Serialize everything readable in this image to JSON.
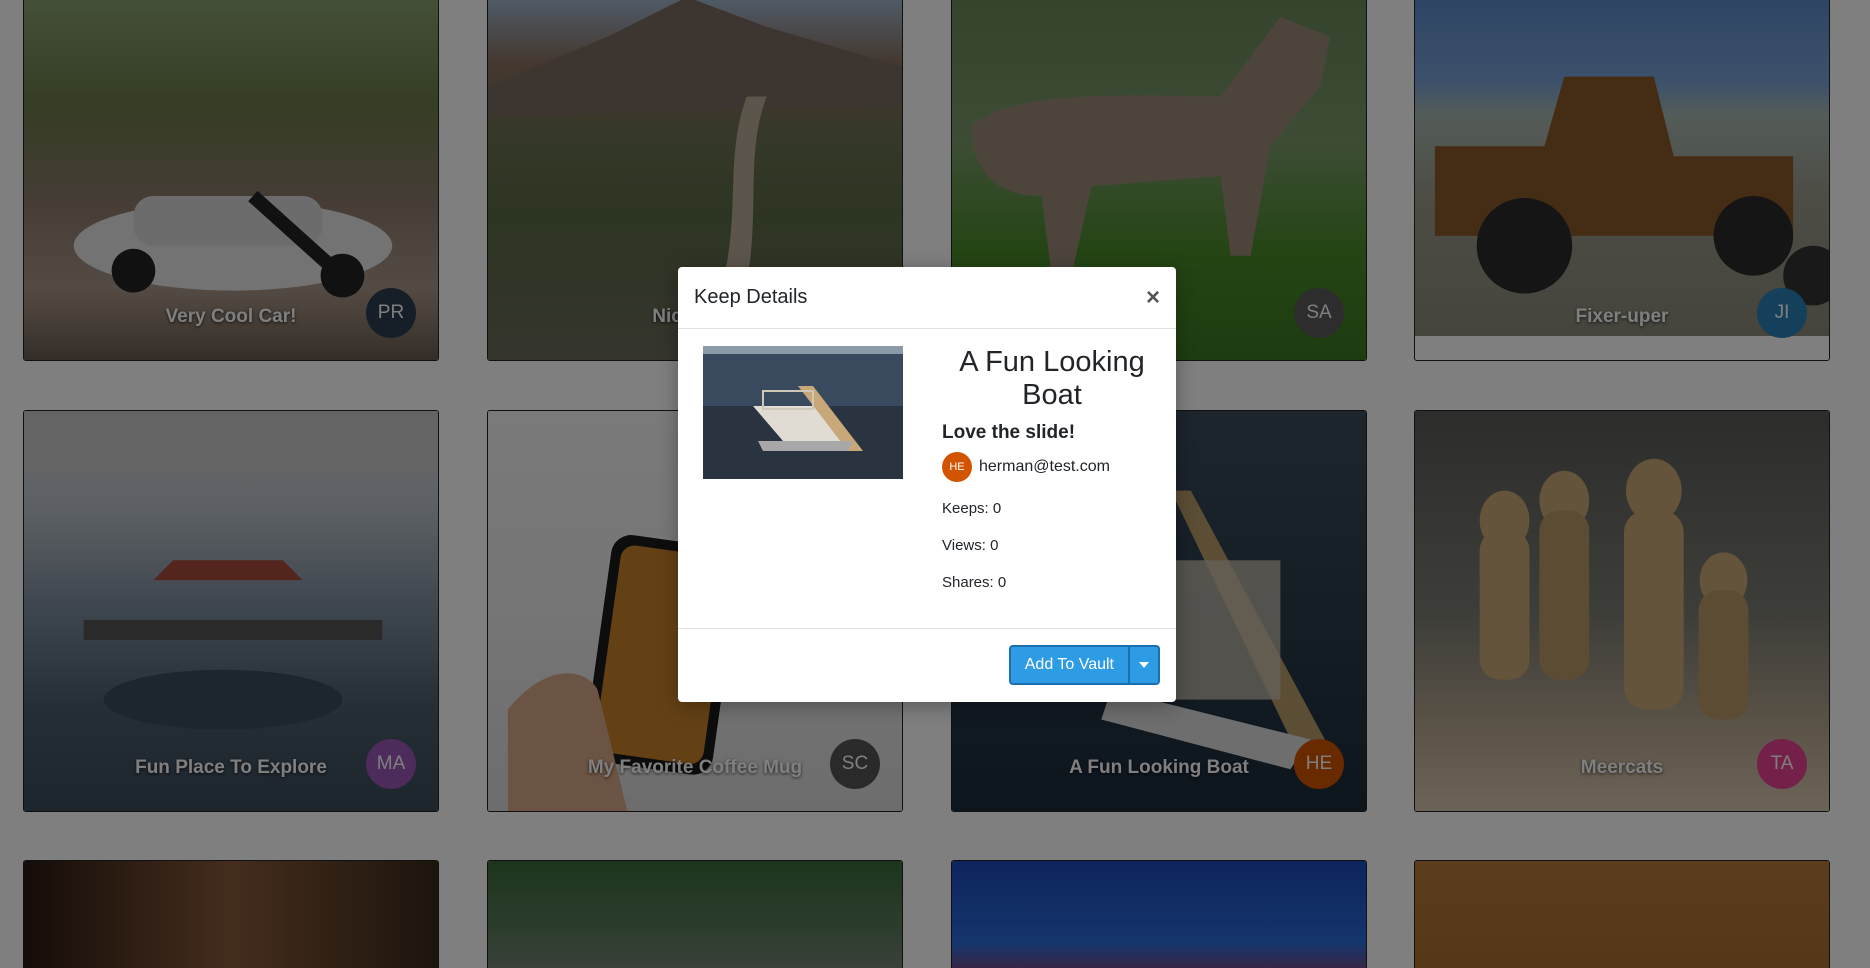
{
  "cards": [
    {
      "title": "Very Cool Car!",
      "avatar": "PR",
      "avatar_color": "#2c3e50"
    },
    {
      "title": "Nice Hike",
      "avatar": "",
      "avatar_color": "#2c3e50"
    },
    {
      "title": "",
      "avatar": "SA",
      "avatar_color": "#5a5a5a"
    },
    {
      "title": "Fixer-uper",
      "avatar": "JI",
      "avatar_color": "#2980b9"
    },
    {
      "title": "Fun Place To Explore",
      "avatar": "MA",
      "avatar_color": "#9b59b6"
    },
    {
      "title": "My Favorite Coffee Mug",
      "avatar": "SC",
      "avatar_color": "#555555"
    },
    {
      "title": "A Fun Looking Boat",
      "avatar": "HE",
      "avatar_color": "#d35400"
    },
    {
      "title": "Meercats",
      "avatar": "TA",
      "avatar_color": "#e84393"
    },
    {
      "title": "",
      "avatar": "",
      "avatar_color": "#000000"
    },
    {
      "title": "",
      "avatar": "",
      "avatar_color": "#000000"
    },
    {
      "title": "",
      "avatar": "",
      "avatar_color": "#000000"
    },
    {
      "title": "",
      "avatar": "",
      "avatar_color": "#000000"
    }
  ],
  "modal": {
    "title": "Keep Details",
    "close_icon": "×",
    "keep_name": "A Fun Looking Boat",
    "description": "Love the slide!",
    "creator_initials": "HE",
    "creator_email": "herman@test.com",
    "keeps": "Keeps: 0",
    "views": "Views: 0",
    "shares": "Shares: 0",
    "add_button": "Add To Vault"
  },
  "colors": {
    "primary": "#2e9be5",
    "creator_avatar": "#d35400"
  }
}
